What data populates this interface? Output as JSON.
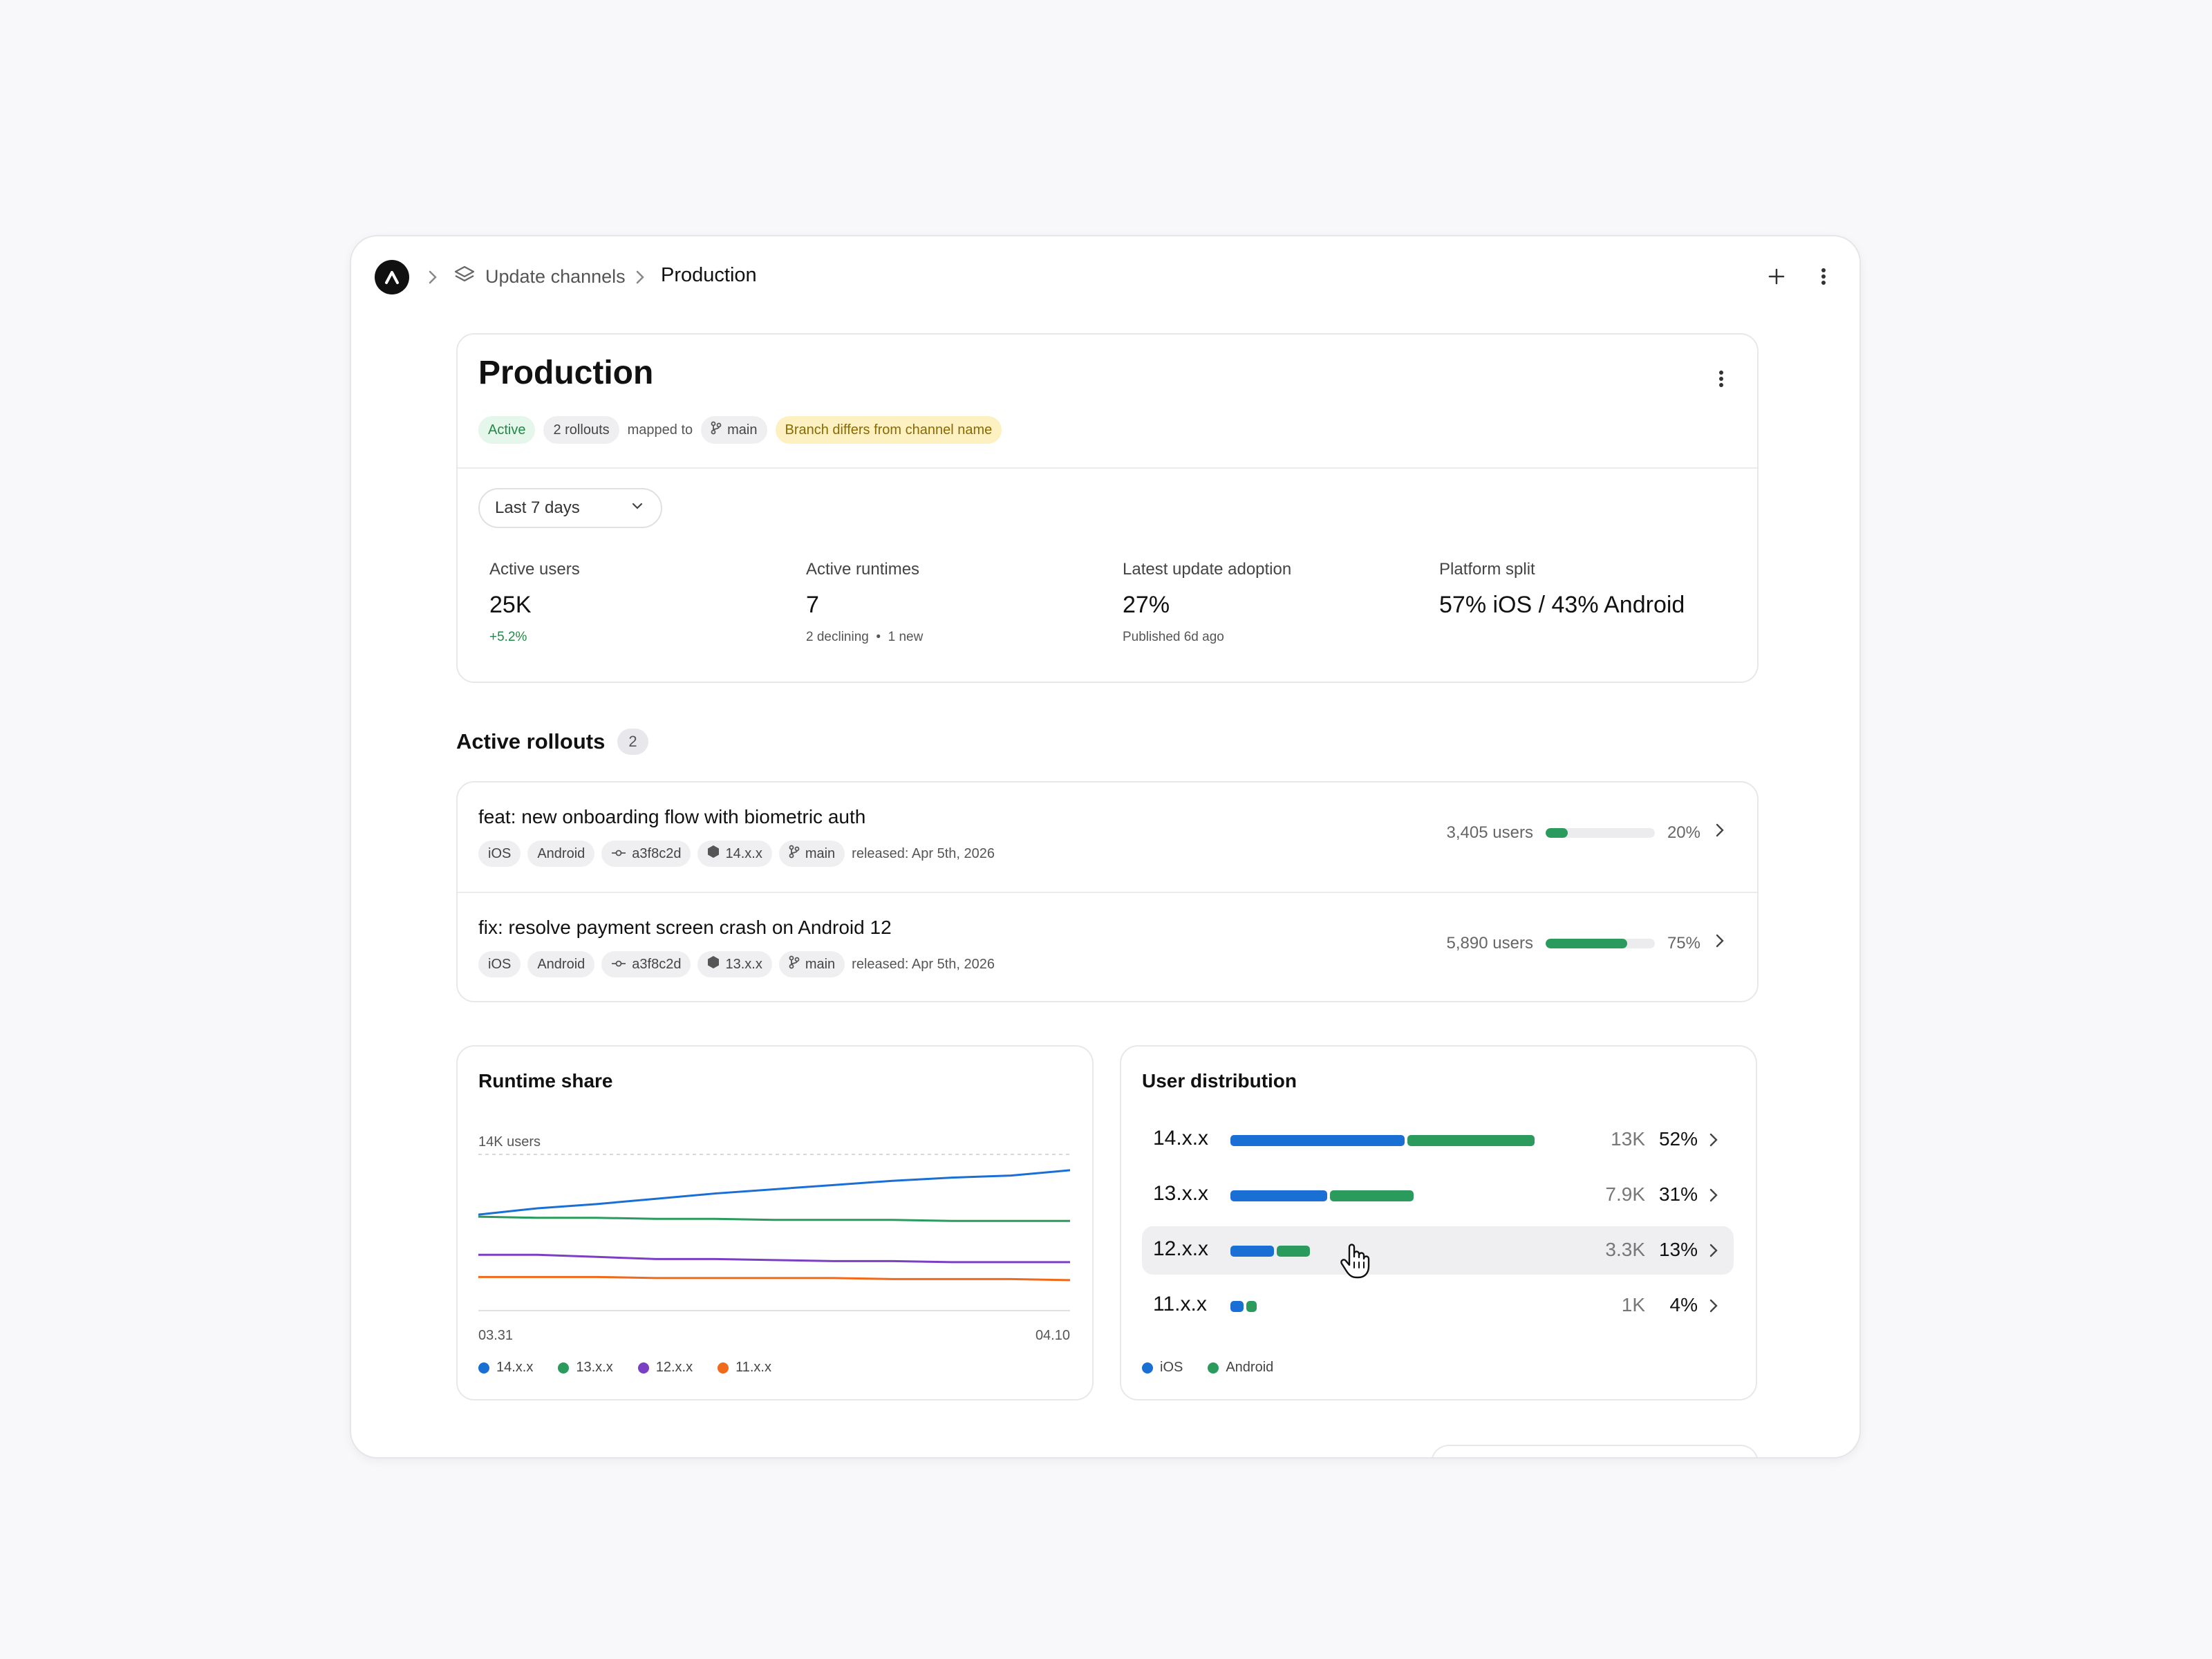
{
  "breadcrumb": {
    "parent": "Update channels",
    "current": "Production"
  },
  "channel": {
    "title": "Production",
    "status": "Active",
    "rollouts_count": "2 rollouts",
    "mapped_text": "mapped to",
    "branch": "main",
    "warning": "Branch differs from channel name"
  },
  "filter": {
    "range": "Last 7 days"
  },
  "metrics": [
    {
      "label": "Active users",
      "value": "25K",
      "sub": "+5.2%"
    },
    {
      "label": "Active runtimes",
      "value": "7",
      "sub": "2 declining  •  1 new"
    },
    {
      "label": "Latest update adoption",
      "value": "27%",
      "sub": "Published 6d ago"
    },
    {
      "label": "Platform split",
      "value": "57% iOS / 43% Android",
      "sub": ""
    }
  ],
  "rollouts": {
    "title": "Active rollouts",
    "count": "2",
    "items": [
      {
        "title": "feat: new onboarding flow with biometric auth",
        "platforms": [
          "iOS",
          "Android"
        ],
        "commit": "a3f8c2d",
        "runtime": "14.x.x",
        "branch": "main",
        "released": "released: Apr 5th, 2026",
        "users": "3,405 users",
        "percent_label": "20%",
        "progress": 0.2
      },
      {
        "title": "fix: resolve payment screen crash on Android 12",
        "platforms": [
          "iOS",
          "Android"
        ],
        "commit": "a3f8c2d",
        "runtime": "13.x.x",
        "branch": "main",
        "released": "released: Apr 5th, 2026",
        "users": "5,890 users",
        "percent_label": "75%",
        "progress": 0.75
      }
    ]
  },
  "runtime_share": {
    "title": "Runtime share",
    "y_label": "14K users",
    "x_start": "03.31",
    "x_end": "04.10",
    "legend": [
      "14.x.x",
      "13.x.x",
      "12.x.x",
      "11.x.x"
    ]
  },
  "chart_data": {
    "type": "line",
    "title": "Runtime share",
    "x": [
      "03.31",
      "04.01",
      "04.02",
      "04.03",
      "04.04",
      "04.05",
      "04.06",
      "04.07",
      "04.08",
      "04.09",
      "04.10"
    ],
    "ylim": [
      0,
      14000
    ],
    "series": [
      {
        "name": "14.x.x",
        "color": "#1a6fd4",
        "values": [
          8300,
          8900,
          9300,
          9800,
          10300,
          10700,
          11100,
          11500,
          11800,
          12000,
          12500
        ]
      },
      {
        "name": "13.x.x",
        "color": "#2a9a5d",
        "values": [
          8100,
          8000,
          8000,
          7900,
          7900,
          7800,
          7800,
          7800,
          7700,
          7700,
          7700
        ]
      },
      {
        "name": "12.x.x",
        "color": "#7b3fc4",
        "values": [
          4500,
          4500,
          4300,
          4100,
          4100,
          4000,
          3900,
          3900,
          3800,
          3800,
          3800
        ]
      },
      {
        "name": "11.x.x",
        "color": "#f06a1a",
        "values": [
          2400,
          2400,
          2400,
          2300,
          2300,
          2300,
          2300,
          2200,
          2200,
          2200,
          2100
        ]
      }
    ]
  },
  "distribution": {
    "title": "User distribution",
    "legend": [
      "iOS",
      "Android"
    ],
    "colors": {
      "ios": "#1a6fd4",
      "android": "#2a9a5d"
    },
    "rows": [
      {
        "label": "14.x.x",
        "count": "13K",
        "pct": "52%",
        "ios": 0.52,
        "android": 0.38
      },
      {
        "label": "13.x.x",
        "count": "7.9K",
        "pct": "31%",
        "ios": 0.29,
        "android": 0.25
      },
      {
        "label": "12.x.x",
        "count": "3.3K",
        "pct": "13%",
        "ios": 0.13,
        "android": 0.1
      },
      {
        "label": "11.x.x",
        "count": "1K",
        "pct": "4%",
        "ios": 0.04,
        "android": 0.03
      }
    ]
  }
}
